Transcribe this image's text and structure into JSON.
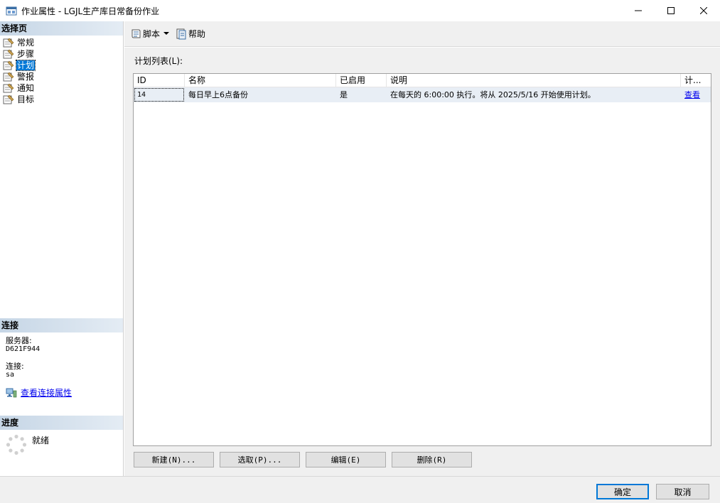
{
  "window": {
    "title": "作业属性 - LGJL生产库日常备份作业",
    "minimize": "—",
    "maximize": "☐",
    "close": "✕"
  },
  "left": {
    "select_page_header": "选择页",
    "pages": [
      {
        "label": "常规",
        "icon": "wrench-page-icon"
      },
      {
        "label": "步骤",
        "icon": "wrench-page-icon"
      },
      {
        "label": "计划",
        "icon": "wrench-page-icon",
        "selected": true
      },
      {
        "label": "警报",
        "icon": "wrench-page-icon"
      },
      {
        "label": "通知",
        "icon": "wrench-page-icon"
      },
      {
        "label": "目标",
        "icon": "wrench-page-icon"
      }
    ],
    "connection_header": "连接",
    "server_label": "服务器:",
    "server_value": "D621F944",
    "connection_label": "连接:",
    "connection_value": "sa",
    "view_connection_props": "查看连接属性",
    "progress_header": "进度",
    "progress_status": "就绪"
  },
  "toolbar": {
    "script_label": "脚本",
    "help_label": "帮助"
  },
  "schedule": {
    "list_label": "计划列表(L):",
    "columns": [
      "ID",
      "名称",
      "已启用",
      "说明",
      "计..."
    ],
    "rows": [
      {
        "id": "14",
        "name": "每日早上6点备份",
        "enabled": "是",
        "description": "在每天的 6:00:00 执行。将从 2025/5/16 开始使用计划。",
        "link": "查看"
      }
    ]
  },
  "actions": {
    "new": "新建(N)...",
    "pick": "选取(P)...",
    "edit": "编辑(E)",
    "delete": "删除(R)"
  },
  "footer": {
    "ok": "确定",
    "cancel": "取消"
  },
  "colors": {
    "selected": "#0078d7",
    "link": "#0000ee",
    "header_gradient_start": "#c6d6e6"
  }
}
